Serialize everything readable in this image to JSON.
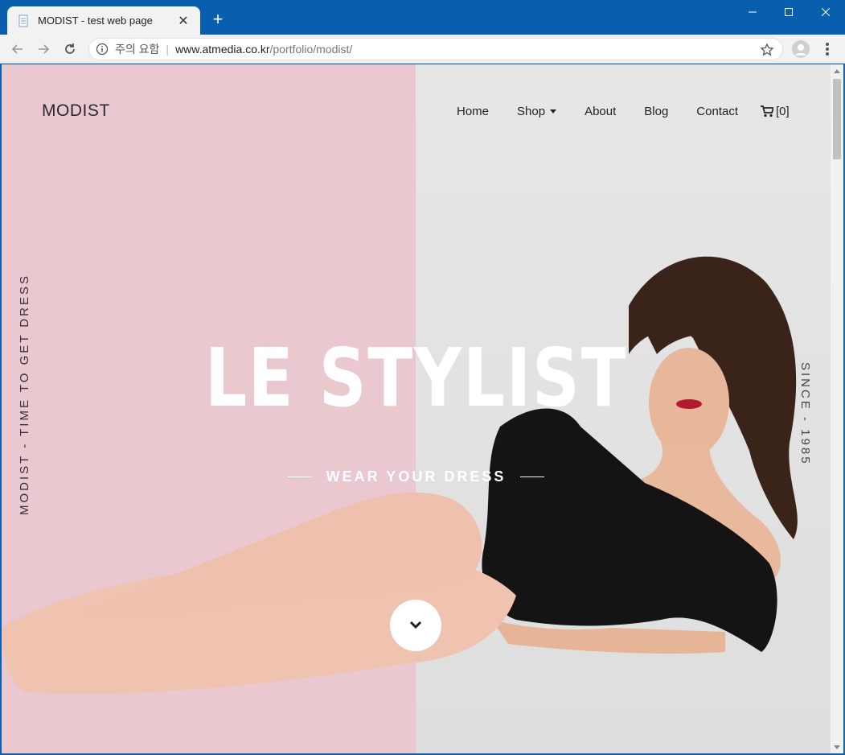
{
  "browser": {
    "tab_title": "MODIST - test web page",
    "security_label": "주의 요함",
    "url_host": "www.atmedia.co.kr",
    "url_path": "/portfolio/modist/"
  },
  "site": {
    "logo": "MODIST",
    "nav": [
      {
        "label": "Home"
      },
      {
        "label": "Shop"
      },
      {
        "label": "About"
      },
      {
        "label": "Blog"
      },
      {
        "label": "Contact"
      }
    ],
    "cart_count": "[0]",
    "side_left": "MODIST - TIME TO GET DRESS",
    "side_right": "SINCE - 1985",
    "hero_title": "LE STYLIST",
    "hero_subtitle": "WEAR YOUR DRESS"
  },
  "colors": {
    "titlebar": "#0a5eae",
    "left_panel": "#eac8d0",
    "right_panel": "#e3e3e3"
  }
}
